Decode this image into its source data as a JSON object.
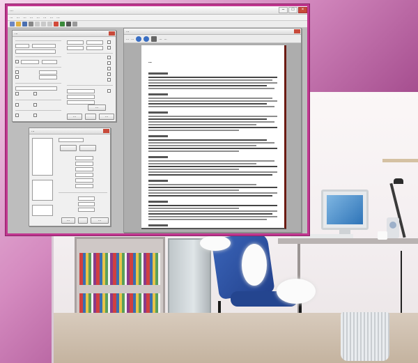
{
  "app": {
    "window_title": "...",
    "menus": [
      "...",
      "...",
      "...",
      "...",
      "...",
      "...",
      "...",
      "..."
    ]
  },
  "dialogs": {
    "options_main": {
      "title": "...",
      "ok_label": "...",
      "cancel_label": "...",
      "apply_label": "..."
    },
    "options_small": {
      "title": "...",
      "ok_label": "...",
      "cancel_label": "..."
    }
  },
  "preview": {
    "title": "...",
    "document_title": "...",
    "toolbar_labels": [
      "...",
      "...",
      "...",
      "..."
    ]
  },
  "colors": {
    "frame_accent": "#c0368f",
    "background_dark": "#7a2a6b",
    "close_button": "#c84a3a"
  }
}
